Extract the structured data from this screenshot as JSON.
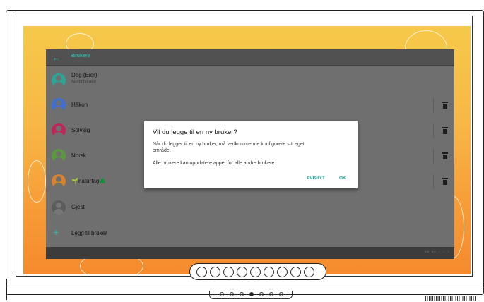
{
  "app": {
    "title": "Brukere"
  },
  "users": [
    {
      "name": "Deg (Eier)",
      "sub": "Administrator",
      "avatar_color": "#2ba596",
      "deletable": false
    },
    {
      "name": "Håkon",
      "sub": "",
      "avatar_color": "#3f6fd1",
      "deletable": true
    },
    {
      "name": "Solveig",
      "sub": "",
      "avatar_color": "#c0265a",
      "deletable": true
    },
    {
      "name": "Norsk",
      "sub": "",
      "avatar_color": "#5a9a3a",
      "deletable": true
    },
    {
      "name": "🌱naturfag🌲",
      "sub": "",
      "avatar_color": "#d9822b",
      "deletable": true
    },
    {
      "name": "Gjest",
      "sub": "",
      "avatar_color": "#5c5c5c",
      "deletable": false
    }
  ],
  "add_user": {
    "label": "Legg til bruker"
  },
  "dialog": {
    "title": "Vil du legge til en ny bruker?",
    "body1": "Når du legger til en ny bruker, må vedkommende konfigurere sitt eget område.",
    "body2": "Alle brukere kan oppdatere apper for alle andre brukere.",
    "cancel": "AVBRYT",
    "ok": "OK"
  },
  "colors": {
    "accent": "#2fb5a5",
    "app_background": "#6f6f6f",
    "wallpaper_top": "#f6c94a",
    "wallpaper_bottom": "#f58a2c"
  },
  "icons": {
    "back": "arrow-left-icon",
    "delete": "trash-icon",
    "add": "plus-icon"
  }
}
